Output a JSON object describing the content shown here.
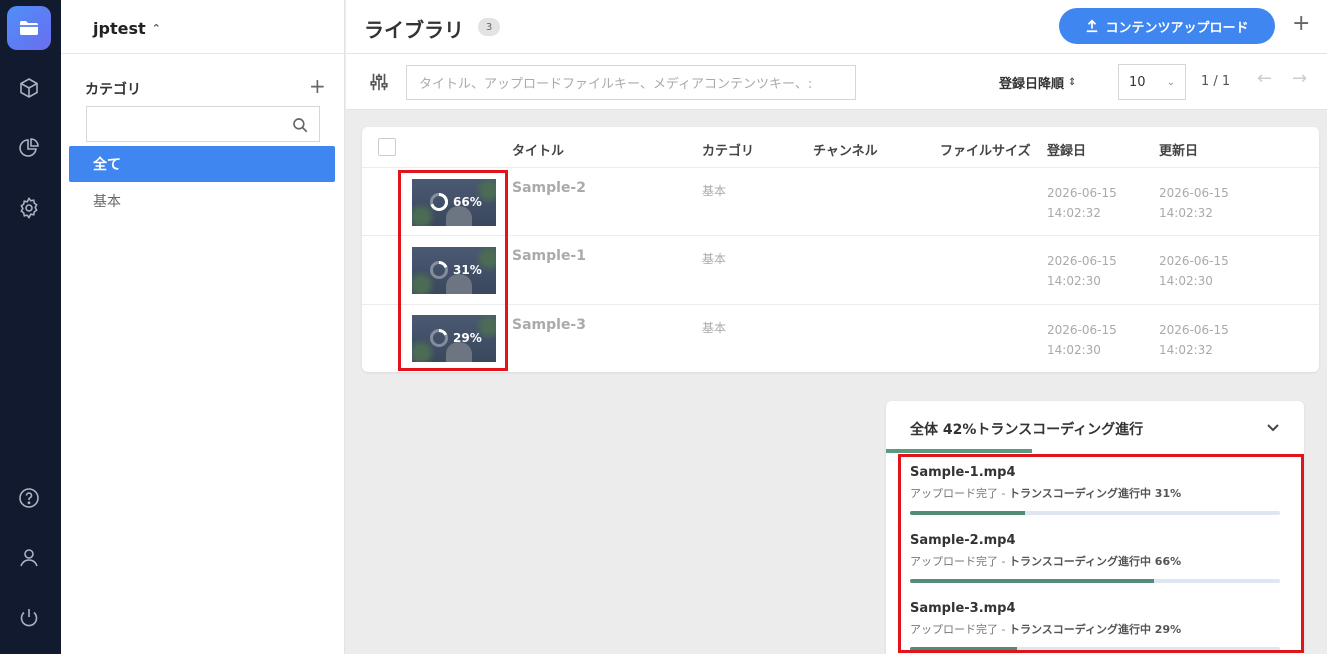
{
  "workspace": {
    "name": "jptest"
  },
  "categories": {
    "title": "カテゴリ",
    "search_value": "",
    "items": [
      {
        "label": "全て",
        "active": true
      },
      {
        "label": "基本",
        "active": false
      }
    ]
  },
  "header": {
    "title": "ライブラリ",
    "count": "3",
    "upload_label": "コンテンツアップロード"
  },
  "toolbar": {
    "search_placeholder": "タイトル、アップロードファイルキー、メディアコンテンツキー、:",
    "sort_label": "登録日降順",
    "page_size": "10",
    "page_info": "1 / 1"
  },
  "table": {
    "columns": [
      "タイトル",
      "カテゴリ",
      "チャンネル",
      "ファイルサイズ",
      "登録日",
      "更新日"
    ],
    "rows": [
      {
        "progress_label": "66%",
        "progress": 0.66,
        "title": "Sample-2",
        "category": "基本",
        "channel": "",
        "file_size": "",
        "created_date": "2026-06-15",
        "created_time": "14:02:32",
        "updated_date": "2026-06-15",
        "updated_time": "14:02:32"
      },
      {
        "progress_label": "31%",
        "progress": 0.31,
        "title": "Sample-1",
        "category": "基本",
        "channel": "",
        "file_size": "",
        "created_date": "2026-06-15",
        "created_time": "14:02:30",
        "updated_date": "2026-06-15",
        "updated_time": "14:02:30"
      },
      {
        "progress_label": "29%",
        "progress": 0.29,
        "title": "Sample-3",
        "category": "基本",
        "channel": "",
        "file_size": "",
        "created_date": "2026-06-15",
        "created_time": "14:02:30",
        "updated_date": "2026-06-15",
        "updated_time": "14:02:32"
      }
    ]
  },
  "transcoding": {
    "title": "全体 42%トランスコーディング進行",
    "overall_progress": 0.42,
    "items": [
      {
        "name": "Sample-1.mp4",
        "status_prefix": "アップロード完了 - ",
        "status_main": "トランスコーディング進行中 31%",
        "progress": 0.31
      },
      {
        "name": "Sample-2.mp4",
        "status_prefix": "アップロード完了 - ",
        "status_main": "トランスコーディング進行中 66%",
        "progress": 0.66
      },
      {
        "name": "Sample-3.mp4",
        "status_prefix": "アップロード完了 - ",
        "status_main": "トランスコーディング進行中 29%",
        "progress": 0.29
      }
    ]
  },
  "colors": {
    "rail_bg": "#111a2e",
    "accent": "#3f86f0",
    "progress": "#4f8e74",
    "highlight": "#e0141a"
  },
  "icons": {
    "rail": [
      "folder-icon",
      "cube-icon",
      "pie-chart-icon",
      "gear-icon",
      "help-icon",
      "user-icon",
      "power-icon"
    ]
  }
}
